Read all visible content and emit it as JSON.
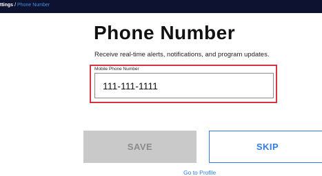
{
  "breadcrumb": {
    "parent": "ttings",
    "separator": "/",
    "current": "Phone Number"
  },
  "page": {
    "title": "Phone Number",
    "subtitle": "Receive real-time alerts, notifications, and program updates."
  },
  "phone_field": {
    "label": "Mobile Phone Number",
    "value": "111-111-1111"
  },
  "actions": {
    "save_label": "SAVE",
    "skip_label": "SKIP",
    "profile_link": "Go to Profile"
  },
  "colors": {
    "topbar": "#0c1230",
    "accent": "#2f7ee6",
    "highlight_outline": "#d6343c",
    "disabled_button": "#c9c9c9"
  }
}
